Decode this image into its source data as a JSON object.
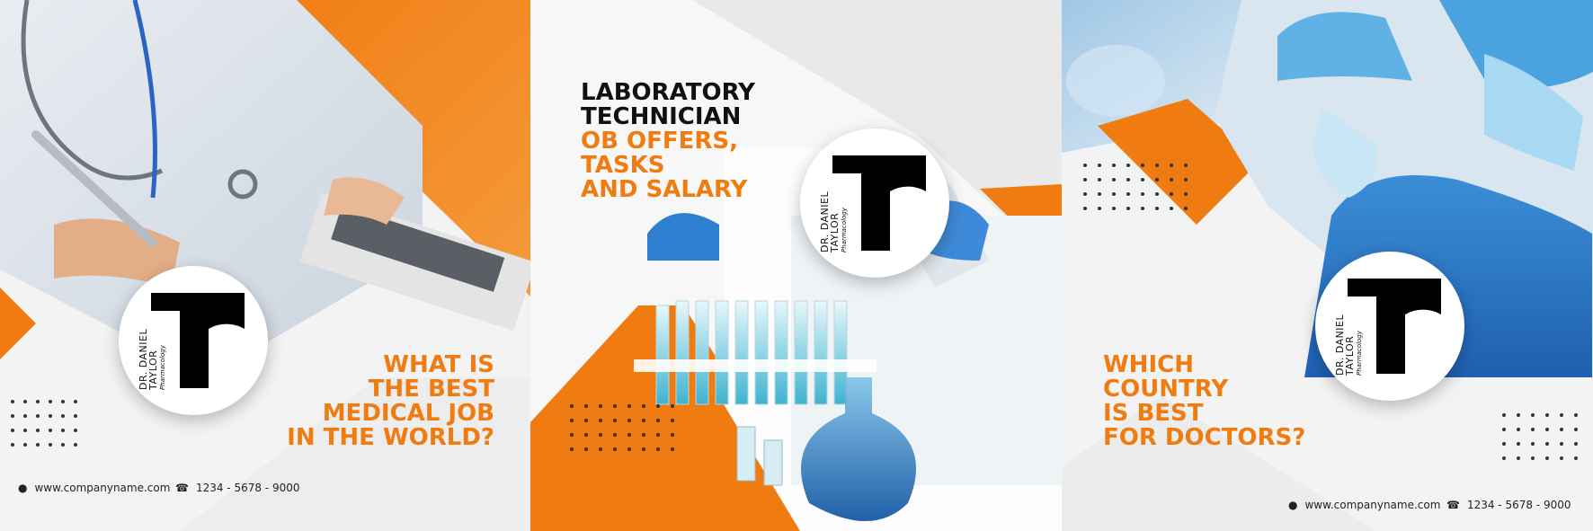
{
  "panel1": {
    "headline": [
      "WHAT IS",
      "THE BEST",
      "MEDICAL JOB",
      "IN THE WORLD?"
    ],
    "logo": {
      "name_line1": "DR. DANIEL",
      "name_line2": "TAYLOR",
      "subtitle": "Pharmacology"
    },
    "footer": {
      "website": "www.companyname.com",
      "phone": "1234 - 5678 - 9000",
      "globe_icon": "globe-icon",
      "phone_icon": "phone-icon"
    }
  },
  "panel2": {
    "headline_black": [
      "LABORATORY",
      "TECHNICIAN"
    ],
    "headline_orange": [
      "OB OFFERS,",
      "TASKS",
      "AND SALARY"
    ],
    "logo": {
      "name_line1": "DR. DANIEL",
      "name_line2": "TAYLOR",
      "subtitle": "Pharmacology"
    }
  },
  "panel3": {
    "headline": [
      "WHICH",
      "COUNTRY",
      "IS BEST",
      "FOR DOCTORS?"
    ],
    "logo": {
      "name_line1": "DR. DANIEL",
      "name_line2": "TAYLOR",
      "subtitle": "Pharmacology"
    },
    "footer": {
      "website": "www.companyname.com",
      "phone": "1234 - 5678 - 9000",
      "globe_icon": "globe-icon",
      "phone_icon": "phone-icon"
    }
  },
  "colors": {
    "accent": "#f07c11",
    "text_dark": "#111111",
    "background": "#f4f4f4"
  }
}
